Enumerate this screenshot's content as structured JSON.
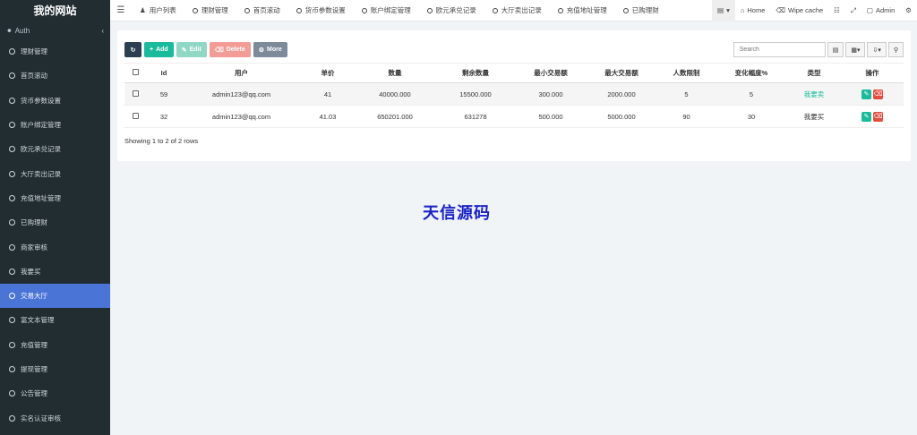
{
  "sidebar": {
    "brand": "我的网站",
    "auth_label": "Auth",
    "collapse_glyph": "‹",
    "items": [
      {
        "label": "理财管理"
      },
      {
        "label": "首页滚动"
      },
      {
        "label": "货币参数设置"
      },
      {
        "label": "账户绑定管理"
      },
      {
        "label": "欧元承兑记录"
      },
      {
        "label": "大厅卖出记录"
      },
      {
        "label": "充值地址管理"
      },
      {
        "label": "已购理财"
      },
      {
        "label": "商家审核"
      },
      {
        "label": "我要买"
      },
      {
        "label": "交易大厅",
        "active": true
      },
      {
        "label": "富文本管理"
      },
      {
        "label": "充值管理"
      },
      {
        "label": "提现管理"
      },
      {
        "label": "公告管理"
      },
      {
        "label": "实名认证审核"
      }
    ]
  },
  "topbar": {
    "tabs": [
      {
        "label": "用户列表",
        "icon": "user-icon"
      },
      {
        "label": "理财管理",
        "icon": "circle-icon"
      },
      {
        "label": "首页滚动",
        "icon": "circle-icon"
      },
      {
        "label": "货币参数设置",
        "icon": "circle-icon"
      },
      {
        "label": "账户绑定管理",
        "icon": "circle-icon"
      },
      {
        "label": "欧元承兑记录",
        "icon": "circle-icon"
      },
      {
        "label": "大厅卖出记录",
        "icon": "circle-icon"
      },
      {
        "label": "充值地址管理",
        "icon": "circle-icon"
      },
      {
        "label": "已购理财",
        "icon": "circle-icon"
      }
    ],
    "home_label": "Home",
    "wipe_label": "Wipe cache",
    "admin_label": "Admin"
  },
  "toolbar": {
    "add_label": "Add",
    "edit_label": "Edit",
    "delete_label": "Delete",
    "more_label": "More"
  },
  "search": {
    "placeholder": "Search"
  },
  "table": {
    "headers": [
      "Id",
      "用户",
      "单价",
      "数量",
      "剩余数量",
      "最小交易额",
      "最大交易额",
      "人数限制",
      "变化幅度%",
      "类型",
      "操作"
    ],
    "rows": [
      {
        "id": "59",
        "user": "admin123@qq.com",
        "price": "41",
        "qty": "40000.000",
        "remain": "15500.000",
        "min": "300.000",
        "max": "2000.000",
        "limit": "5",
        "change": "5",
        "type": "我要卖"
      },
      {
        "id": "32",
        "user": "admin123@qq.com",
        "price": "41.03",
        "qty": "650201.000",
        "remain": "631278",
        "min": "500.000",
        "max": "5000.000",
        "limit": "90",
        "change": "30",
        "type": "我要买"
      }
    ]
  },
  "footer": {
    "showing": "Showing 1 to 2 of 2 rows"
  },
  "watermark": "天信源码",
  "colors": {
    "sidebar": "#222d32",
    "active": "#4a74d6",
    "add": "#18bc9c",
    "delete": "#e74c3c"
  }
}
